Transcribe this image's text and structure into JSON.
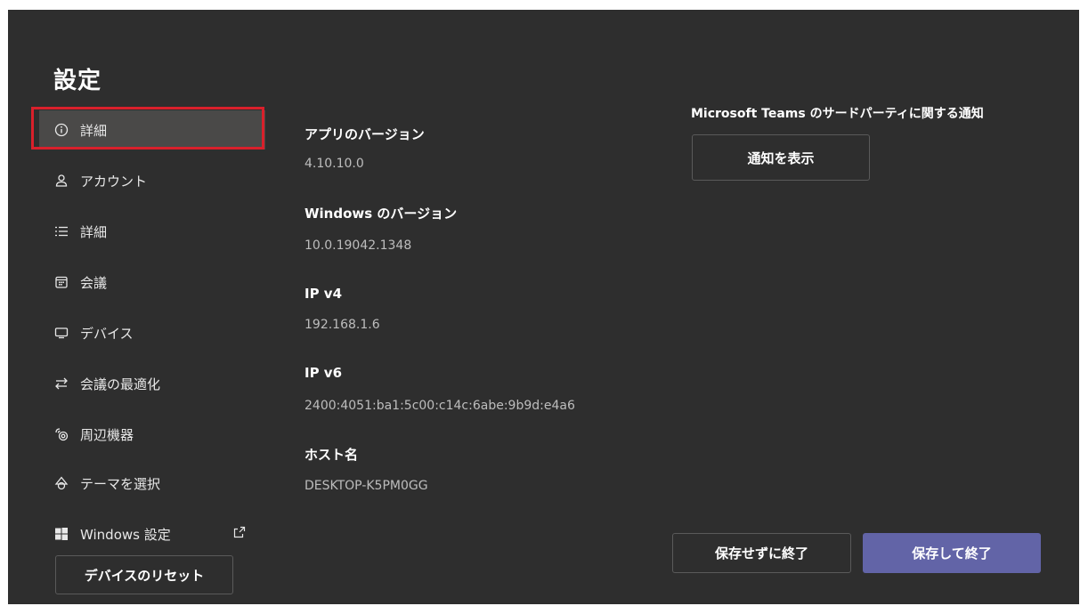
{
  "window": {
    "title": "設定"
  },
  "nav": {
    "items": [
      {
        "label": "詳細",
        "icon": "info-icon"
      },
      {
        "label": "アカウント",
        "icon": "person-icon"
      },
      {
        "label": "詳細",
        "icon": "list-icon"
      },
      {
        "label": "会議",
        "icon": "calendar-icon"
      },
      {
        "label": "デバイス",
        "icon": "device-icon"
      },
      {
        "label": "会議の最適化",
        "icon": "swap-icon"
      },
      {
        "label": "周辺機器",
        "icon": "peripherals-icon"
      },
      {
        "label": "テーマを選択",
        "icon": "shapes-icon"
      },
      {
        "label": "Windows 設定",
        "icon": "windows-icon"
      }
    ],
    "reset_label": "デバイスのリセット"
  },
  "info": {
    "app_version_label": "アプリのバージョン",
    "app_version": "4.10.10.0",
    "windows_version_label": "Windows のバージョン",
    "windows_version": "10.0.19042.1348",
    "ipv4_label": "IP v4",
    "ipv4": "192.168.1.6",
    "ipv6_label": "IP v6",
    "ipv6": "2400:4051:ba1:5c00:c14c:6abe:9b9d:e4a6",
    "host_label": "ホスト名",
    "host": "DESKTOP-K5PM0GG"
  },
  "notice": {
    "title": "Microsoft Teams のサードパーティに関する通知",
    "button": "通知を表示"
  },
  "footer": {
    "discard_label": "保存せずに終了",
    "save_label": "保存して終了"
  },
  "colors": {
    "background": "#2e2e2e",
    "accent": "#6264a7",
    "highlight": "#d9202b"
  }
}
